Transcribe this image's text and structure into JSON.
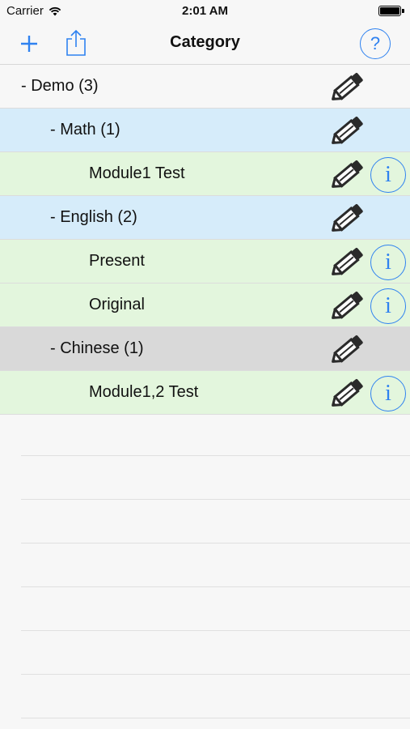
{
  "status_bar": {
    "carrier": "Carrier",
    "time": "2:01 AM"
  },
  "nav": {
    "title": "Category",
    "help_label": "?"
  },
  "rows": [
    {
      "label": "- Demo (3)",
      "level": 0,
      "color": "#f7f7f7",
      "has_info": false
    },
    {
      "label": "- Math (1)",
      "level": 1,
      "color": "#d6ecfa",
      "has_info": false
    },
    {
      "label": "Module1 Test",
      "level": 2,
      "color": "#e3f6dd",
      "has_info": true
    },
    {
      "label": "- English (2)",
      "level": 1,
      "color": "#d6ecfa",
      "has_info": false
    },
    {
      "label": "Present",
      "level": 2,
      "color": "#e3f6dd",
      "has_info": true
    },
    {
      "label": "Original",
      "level": 2,
      "color": "#e3f6dd",
      "has_info": true
    },
    {
      "label": "- Chinese (1)",
      "level": 1,
      "color": "#d9d9d9",
      "has_info": false
    },
    {
      "label": "Module1,2 Test",
      "level": 2,
      "color": "#e3f6dd",
      "has_info": true
    }
  ],
  "icons": {
    "edit": "pencil-icon",
    "info": "info-icon",
    "add": "plus-icon",
    "share": "share-icon",
    "help": "help-icon"
  },
  "colors": {
    "accent": "#2f82f0"
  },
  "info_glyph": "i"
}
